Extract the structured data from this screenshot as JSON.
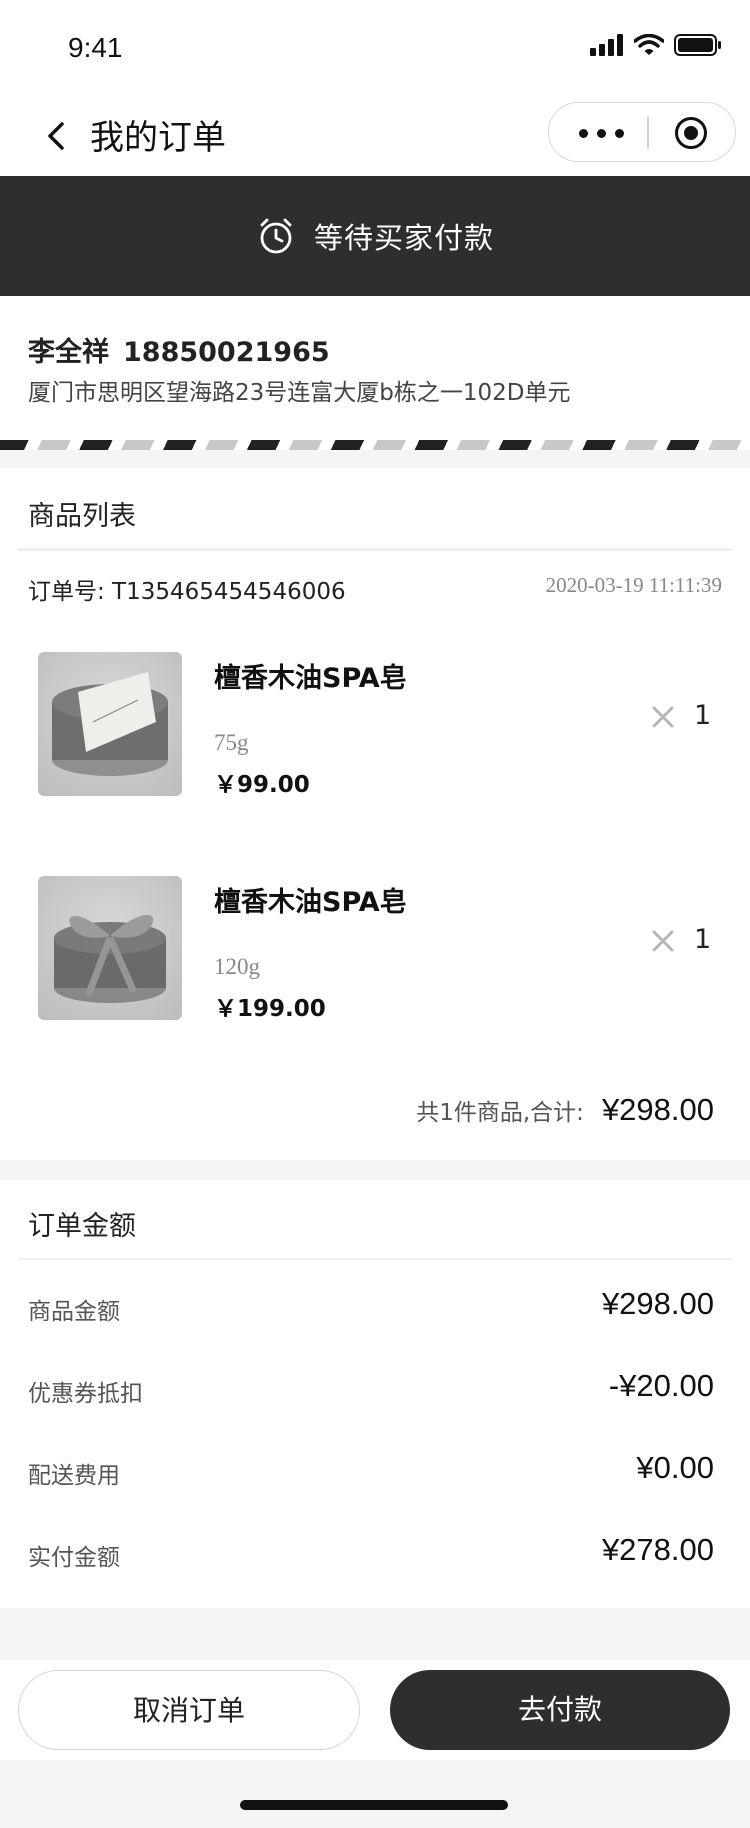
{
  "status_bar": {
    "time": "9:41"
  },
  "nav": {
    "title": "我的订单"
  },
  "banner": {
    "text": "等待买家付款"
  },
  "address": {
    "name": "李全祥",
    "phone": "18850021965",
    "detail": "厦门市思明区望海路23号连富大厦b栋之一102D单元"
  },
  "goods": {
    "title": "商品列表",
    "order_no": "订单号: T135465454546006",
    "order_time": "2020-03-19 11:11:39",
    "items": [
      {
        "name": "檀香木油SPA皂",
        "spec": "75g",
        "price": "￥99.00",
        "qty": "1"
      },
      {
        "name": "檀香木油SPA皂",
        "spec": "120g",
        "price": "￥199.00",
        "qty": "1"
      }
    ],
    "total_label": "共1件商品,合计:",
    "total_value": "¥298.00"
  },
  "amount": {
    "title": "订单金额",
    "rows": [
      {
        "label": "商品金额",
        "value": "¥298.00"
      },
      {
        "label": "优惠券抵扣",
        "value": "-¥20.00"
      },
      {
        "label": "配送费用",
        "value": "¥0.00"
      },
      {
        "label": "实付金额",
        "value": "¥278.00"
      }
    ]
  },
  "actions": {
    "cancel": "取消订单",
    "pay": "去付款"
  },
  "icons": {
    "signal": "signal-icon",
    "wifi": "wifi-icon",
    "battery": "battery-icon",
    "back": "back-arrow-icon",
    "more": "more-dots-icon",
    "close_app": "target-icon",
    "alarm": "alarm-clock-icon",
    "multiply": "multiply-icon"
  },
  "colors": {
    "dark": "#2e2e2e",
    "muted": "#888888",
    "background": "#f5f5f5"
  }
}
